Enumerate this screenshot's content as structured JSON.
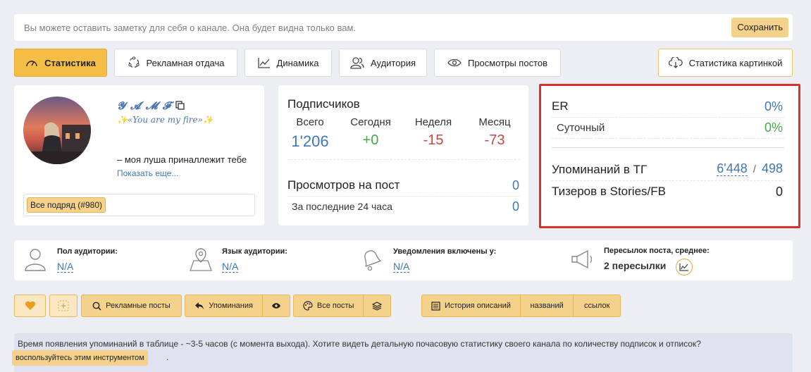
{
  "note": {
    "placeholder": "Вы можете оставить заметку для себя о канале. Она будет видна только вам.",
    "save_label": "Сохранить"
  },
  "tabs": [
    {
      "label": "Статистика",
      "icon": "speedometer-icon",
      "active": true
    },
    {
      "label": "Рекламная отдача",
      "icon": "cycle-icon"
    },
    {
      "label": "Динамика",
      "icon": "line-chart-icon"
    },
    {
      "label": "Аудитория",
      "icon": "users-icon"
    },
    {
      "label": "Просмотры постов",
      "icon": "eye-icon"
    },
    {
      "label": "Статистика картинкой",
      "icon": "cloud-download-icon"
    }
  ],
  "channel": {
    "name": "𝓨 𝓐 𝓜 𝓕",
    "tagline": "✨«You are my fire»✨",
    "description": "– моя луша приналлежит тебе",
    "show_more": "Показать еще...",
    "tag": "Все подряд (#980)"
  },
  "subscribers": {
    "title": "Подписчиков",
    "cols": [
      {
        "label": "Всего",
        "value": "1'206",
        "color": "#3f77b4"
      },
      {
        "label": "Сегодня",
        "value": "+0",
        "color": "#46a946"
      },
      {
        "label": "Неделя",
        "value": "-15",
        "color": "#c94646"
      },
      {
        "label": "Месяц",
        "value": "-73",
        "color": "#c94646"
      }
    ],
    "views_title": "Просмотров на пост",
    "views_value": "0",
    "views_24_label": "За последние 24 часа",
    "views_24_value": "0"
  },
  "engagement": {
    "er_label": "ER",
    "er_value": "0%",
    "daily_label": "Суточный",
    "daily_value": "0%",
    "mentions_label": "Упоминаний в ТГ",
    "mentions_value": "6'448",
    "mentions_sep": "/",
    "mentions_value2": "498",
    "stories_label": "Тизеров в Stories/FB",
    "stories_value": "0"
  },
  "audience": {
    "gender_label": "Пол аудитории:",
    "gender_value": "N/A",
    "lang_label": "Язык аудитории:",
    "lang_value": "N/A",
    "notif_label": "Уведомления включены у:",
    "notif_value": "N/A",
    "forwards_label": "Пересылок поста, среднее:",
    "forwards_value": "2 пересылки"
  },
  "actions": {
    "ad_posts": "Рекламные посты",
    "mentions": "Упоминания",
    "all_posts": "Все посты",
    "history": "История описаний",
    "names": "названий",
    "links": "ссылок"
  },
  "info": {
    "text": "Время появления упоминаний в таблице - ~3-5 часов (с момента выхода). Хотите видеть детальную почасовую статистику своего канала по количеству подписок и отписок?",
    "link": "воспользуйтесь этим инструментом",
    "tail": "."
  }
}
